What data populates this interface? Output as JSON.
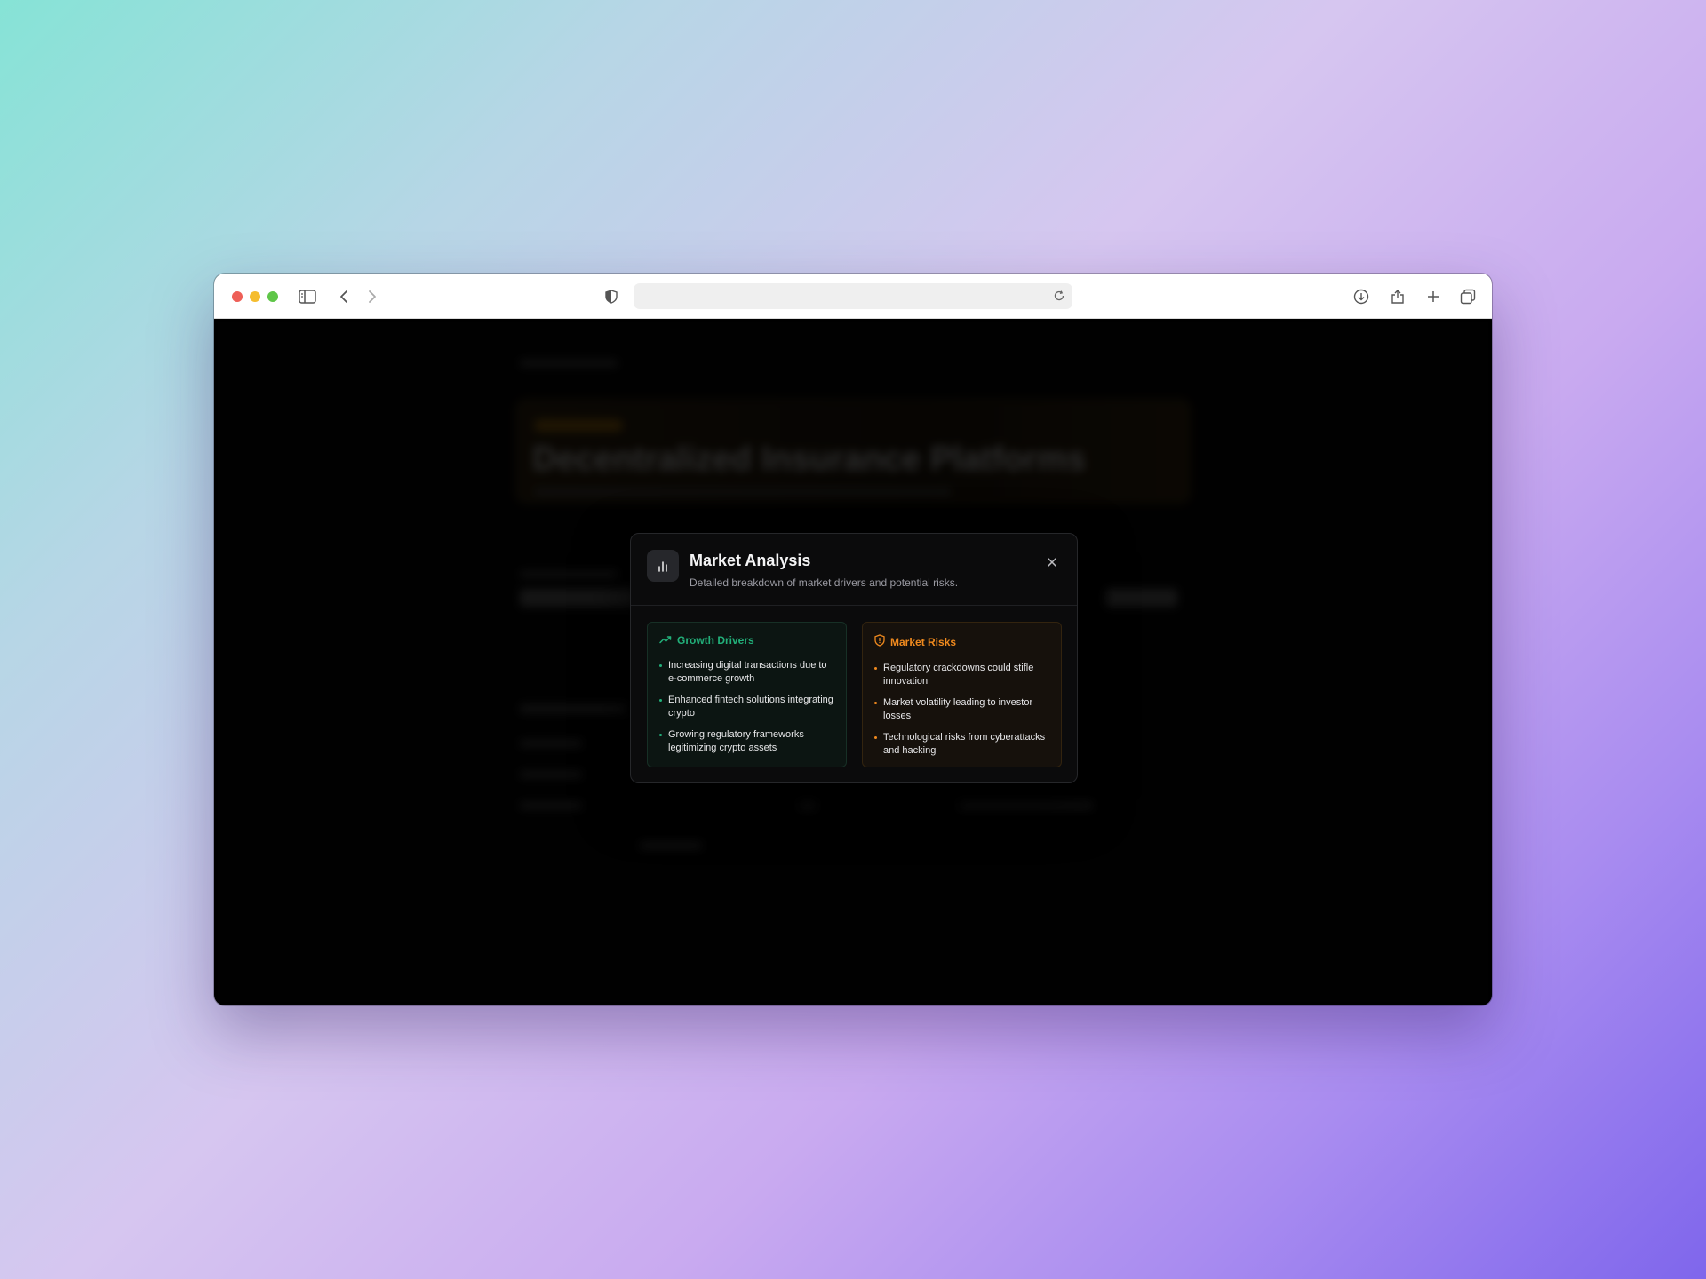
{
  "browser": {
    "url": "",
    "icons": [
      "sidebar-icon",
      "back-icon",
      "forward-icon",
      "shield-icon",
      "reload-icon",
      "download-icon",
      "share-icon",
      "new-tab-icon",
      "tabs-overview-icon"
    ]
  },
  "modal": {
    "title": "Market Analysis",
    "description": "Detailed breakdown of market drivers and potential risks.",
    "icon": "bar-chart-icon",
    "growth": {
      "title": "Growth Drivers",
      "icon": "trending-up-icon",
      "color": "#22b07a",
      "items": [
        "Increasing digital transactions due to e-commerce growth",
        "Enhanced fintech solutions integrating crypto",
        "Growing regulatory frameworks legitimizing crypto assets"
      ]
    },
    "risks": {
      "title": "Market Risks",
      "icon": "shield-alert-icon",
      "color": "#f08a1e",
      "items": [
        "Regulatory crackdowns could stifle innovation",
        "Market volatility leading to investor losses",
        "Technological risks from cyberattacks and hacking"
      ]
    }
  },
  "background_page": {
    "title": "Decentralized Insurance Platforms"
  }
}
